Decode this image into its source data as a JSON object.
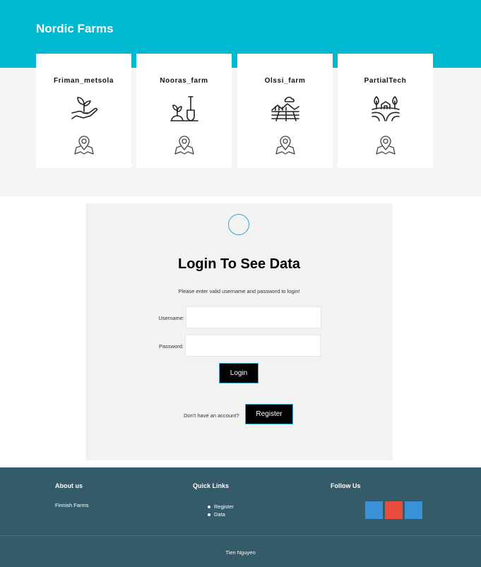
{
  "header": {
    "brand": "Nordic Farms"
  },
  "farms": [
    {
      "name": "Friman_metsola",
      "icon": "hand-sprout-icon"
    },
    {
      "name": "Nooras_farm",
      "icon": "shovel-plant-icon"
    },
    {
      "name": "Olssi_farm",
      "icon": "field-landscape-icon"
    },
    {
      "name": "PartialTech",
      "icon": "farm-trees-icon"
    }
  ],
  "login": {
    "title": "Login To See Data",
    "subtitle": "Please enter valid username and password to login!",
    "username_label": "Username:",
    "username_value": "",
    "password_label": "Password:",
    "password_value": "",
    "login_button": "Login",
    "register_prompt": "Don't have an account?",
    "register_button": "Register"
  },
  "footer": {
    "about_heading": "About us",
    "about_text": "Finnish Farms",
    "links_heading": "Quick Links",
    "links": [
      "Register",
      "Data"
    ],
    "follow_heading": "Follow Us",
    "social_colors": [
      "#3a91d6",
      "#e74c3c",
      "#3a91d6"
    ],
    "copyright": "Tien Nguyen"
  },
  "colors": {
    "header_bg": "#00b8cf",
    "footer_bg": "#335b69",
    "button_bg": "#000000"
  }
}
